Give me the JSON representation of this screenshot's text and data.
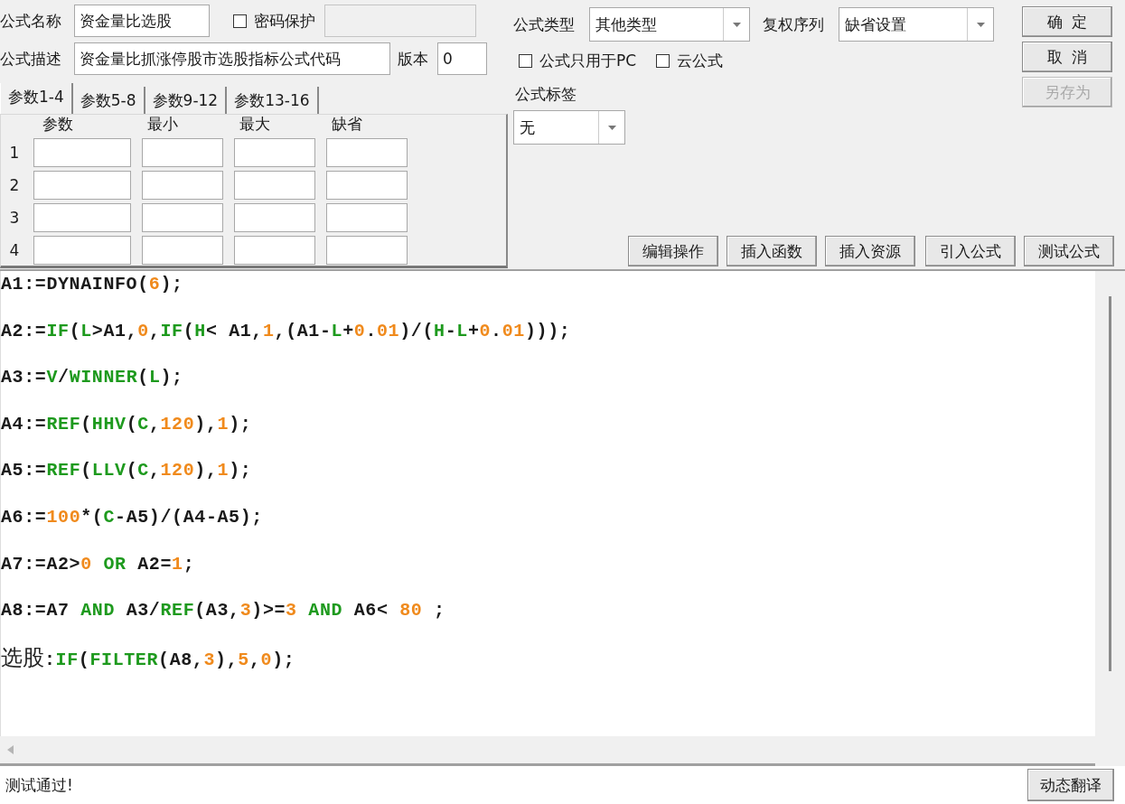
{
  "form": {
    "name_label": "公式名称",
    "name_value": "资金量比选股",
    "password": {
      "label": "密码保护",
      "checked": false
    },
    "desc_label": "公式描述",
    "desc_value": "资金量比抓涨停股市选股指标公式代码",
    "version_label": "版本",
    "version_value": "0"
  },
  "params": {
    "tabs": [
      {
        "label": "参数1-4",
        "selected": true
      },
      {
        "label": "参数5-8",
        "selected": false
      },
      {
        "label": "参数9-12",
        "selected": false
      },
      {
        "label": "参数13-16",
        "selected": false
      }
    ],
    "columns": [
      "参数",
      "最小",
      "最大",
      "缺省"
    ],
    "rows": [
      {
        "index": "1"
      },
      {
        "index": "2"
      },
      {
        "index": "3"
      },
      {
        "index": "4"
      }
    ]
  },
  "options": {
    "type_label": "公式类型",
    "type_value": "其他类型",
    "adjust_label": "复权序列",
    "adjust_value": "缺省设置",
    "checkboxes": [
      {
        "label": "公式只用于PC",
        "checked": false
      },
      {
        "label": "云公式",
        "checked": false
      }
    ],
    "tag_label": "公式标签",
    "tag_value": "无"
  },
  "side_buttons": [
    {
      "label": "确  定",
      "disabled": false
    },
    {
      "label": "取  消",
      "disabled": false
    },
    {
      "label": "另存为",
      "disabled": true
    }
  ],
  "tool_buttons": [
    "编辑操作",
    "插入函数",
    "插入资源",
    "引入公式",
    "测试公式"
  ],
  "code": [
    {
      "tokens": [
        {
          "text": "A1:=DYNAINFO(",
          "kind": "plain"
        },
        {
          "text": "6",
          "kind": "num"
        },
        {
          "text": ");",
          "kind": "plain"
        }
      ]
    },
    {
      "tokens": [
        {
          "text": "A2:=",
          "kind": "plain"
        },
        {
          "text": "IF",
          "kind": "func"
        },
        {
          "text": "(",
          "kind": "plain"
        },
        {
          "text": "L",
          "kind": "func"
        },
        {
          "text": ">A1,",
          "kind": "plain"
        },
        {
          "text": "0",
          "kind": "num"
        },
        {
          "text": ",",
          "kind": "plain"
        },
        {
          "text": "IF",
          "kind": "func"
        },
        {
          "text": "(",
          "kind": "plain"
        },
        {
          "text": "H",
          "kind": "func"
        },
        {
          "text": "< A1,",
          "kind": "plain"
        },
        {
          "text": "1",
          "kind": "num"
        },
        {
          "text": ",(A1-",
          "kind": "plain"
        },
        {
          "text": "L",
          "kind": "func"
        },
        {
          "text": "+",
          "kind": "plain"
        },
        {
          "text": "0",
          "kind": "num"
        },
        {
          "text": ".",
          "kind": "plain"
        },
        {
          "text": "01",
          "kind": "num"
        },
        {
          "text": ")/(",
          "kind": "plain"
        },
        {
          "text": "H",
          "kind": "func"
        },
        {
          "text": "-",
          "kind": "plain"
        },
        {
          "text": "L",
          "kind": "func"
        },
        {
          "text": "+",
          "kind": "plain"
        },
        {
          "text": "0",
          "kind": "num"
        },
        {
          "text": ".",
          "kind": "plain"
        },
        {
          "text": "01",
          "kind": "num"
        },
        {
          "text": ")));",
          "kind": "plain"
        }
      ]
    },
    {
      "tokens": [
        {
          "text": "A3:=",
          "kind": "plain"
        },
        {
          "text": "V",
          "kind": "func"
        },
        {
          "text": "/",
          "kind": "plain"
        },
        {
          "text": "WINNER",
          "kind": "func"
        },
        {
          "text": "(",
          "kind": "plain"
        },
        {
          "text": "L",
          "kind": "func"
        },
        {
          "text": ");",
          "kind": "plain"
        }
      ]
    },
    {
      "tokens": [
        {
          "text": "A4:=",
          "kind": "plain"
        },
        {
          "text": "REF",
          "kind": "func"
        },
        {
          "text": "(",
          "kind": "plain"
        },
        {
          "text": "HHV",
          "kind": "func"
        },
        {
          "text": "(",
          "kind": "plain"
        },
        {
          "text": "C",
          "kind": "func"
        },
        {
          "text": ",",
          "kind": "plain"
        },
        {
          "text": "120",
          "kind": "num"
        },
        {
          "text": "),",
          "kind": "plain"
        },
        {
          "text": "1",
          "kind": "num"
        },
        {
          "text": ");",
          "kind": "plain"
        }
      ]
    },
    {
      "tokens": [
        {
          "text": "A5:=",
          "kind": "plain"
        },
        {
          "text": "REF",
          "kind": "func"
        },
        {
          "text": "(",
          "kind": "plain"
        },
        {
          "text": "LLV",
          "kind": "func"
        },
        {
          "text": "(",
          "kind": "plain"
        },
        {
          "text": "C",
          "kind": "func"
        },
        {
          "text": ",",
          "kind": "plain"
        },
        {
          "text": "120",
          "kind": "num"
        },
        {
          "text": "),",
          "kind": "plain"
        },
        {
          "text": "1",
          "kind": "num"
        },
        {
          "text": ");",
          "kind": "plain"
        }
      ]
    },
    {
      "tokens": [
        {
          "text": "A6:=",
          "kind": "plain"
        },
        {
          "text": "100",
          "kind": "num"
        },
        {
          "text": "*(",
          "kind": "plain"
        },
        {
          "text": "C",
          "kind": "func"
        },
        {
          "text": "-A5)/(A4-A5);",
          "kind": "plain"
        }
      ]
    },
    {
      "tokens": [
        {
          "text": "A7:=A2>",
          "kind": "plain"
        },
        {
          "text": "0",
          "kind": "num"
        },
        {
          "text": " OR",
          "kind": "func"
        },
        {
          "text": " A2=",
          "kind": "plain"
        },
        {
          "text": "1",
          "kind": "num"
        },
        {
          "text": ";",
          "kind": "plain"
        }
      ]
    },
    {
      "tokens": [
        {
          "text": "A8:=A7 ",
          "kind": "plain"
        },
        {
          "text": "AND",
          "kind": "func"
        },
        {
          "text": " A3/",
          "kind": "plain"
        },
        {
          "text": "REF",
          "kind": "func"
        },
        {
          "text": "(A3,",
          "kind": "plain"
        },
        {
          "text": "3",
          "kind": "num"
        },
        {
          "text": ")>=",
          "kind": "plain"
        },
        {
          "text": "3",
          "kind": "num"
        },
        {
          "text": " AND",
          "kind": "func"
        },
        {
          "text": " A6< ",
          "kind": "plain"
        },
        {
          "text": "80",
          "kind": "num"
        },
        {
          "text": " ;",
          "kind": "plain"
        }
      ]
    },
    {
      "tokens": [
        {
          "text": "选股",
          "kind": "cjk"
        },
        {
          "text": ":",
          "kind": "plain"
        },
        {
          "text": "IF",
          "kind": "func"
        },
        {
          "text": "(",
          "kind": "plain"
        },
        {
          "text": "FILTER",
          "kind": "func"
        },
        {
          "text": "(A8,",
          "kind": "plain"
        },
        {
          "text": "3",
          "kind": "num"
        },
        {
          "text": "),",
          "kind": "plain"
        },
        {
          "text": "5",
          "kind": "num"
        },
        {
          "text": ",",
          "kind": "plain"
        },
        {
          "text": "0",
          "kind": "num"
        },
        {
          "text": ");",
          "kind": "plain"
        }
      ]
    }
  ],
  "status_bar": {
    "message": "测试通过!",
    "button": "动态翻译"
  }
}
